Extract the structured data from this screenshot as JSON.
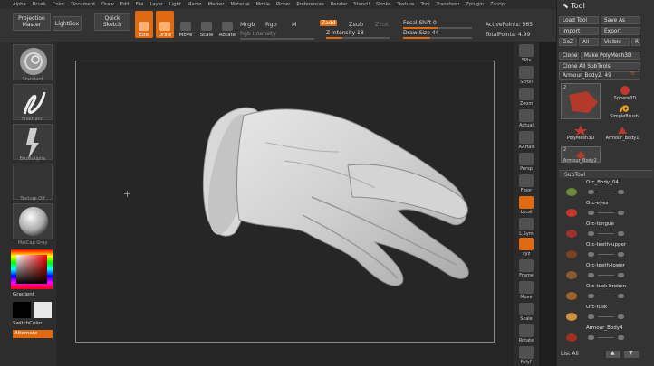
{
  "menubar": [
    "Alpha",
    "Brush",
    "Color",
    "Document",
    "Draw",
    "Edit",
    "File",
    "Layer",
    "Light",
    "Macro",
    "Marker",
    "Material",
    "Movie",
    "Picker",
    "Preferences",
    "Render",
    "Stencil",
    "Stroke",
    "Texture",
    "Tool",
    "Transform",
    "Zplugin",
    "Zscript"
  ],
  "topshelf": {
    "projection_master": "Projection Master",
    "lightbox": "LightBox",
    "quick_sketch": "Quick Sketch",
    "edit": "Edit",
    "draw": "Draw",
    "move": "Move",
    "scale": "Scale",
    "rotate": "Rotate",
    "mrgb": "Mrgb",
    "rgb": "Rgb",
    "m": "M",
    "rgb_intensity": "Rgb Intensity",
    "zadd": "Zadd",
    "zsub": "Zsub",
    "zcut": "Zcut",
    "z_intensity": "Z Intensity 18",
    "focal_shift": "Focal Shift 0",
    "draw_size": "Draw Size 44",
    "active_points": "ActivePoints: 565",
    "total_points": "TotalPoints: 4.99"
  },
  "leftshelf": {
    "standard": "Standard",
    "freehand": "FreeHand",
    "brushalpha": "BrushAlpha",
    "texture_off": "Texture Off",
    "material": "MatCap Gray",
    "gradient": "Gradient",
    "switchcolor": "SwitchColor",
    "alternate": "Alternate"
  },
  "rightshelf": [
    "SPix",
    "Scroll",
    "Zoom",
    "Actual",
    "AAHalf",
    "Persp",
    "Floor",
    "Local",
    "L.Sym",
    "xyz",
    "Frame",
    "Move",
    "Scale",
    "Rotate",
    "PolyF"
  ],
  "toolpanel": {
    "title": "Tool",
    "load_tool": "Load Tool",
    "save_as": "Save As",
    "import": "Import",
    "export": "Export",
    "goz": "GoZ",
    "all": "All",
    "visible": "Visible",
    "r": "R",
    "clone": "Clone",
    "make_polymesh": "Make PolyMesh3D",
    "clone_all_subtools": "Clone All SubTools",
    "current_tool": "Armour_Body2. 49",
    "tools": [
      "Sphere3D",
      "SimpleBrush",
      "PolyMesh3D",
      "Armour_Body1",
      "Armour_Body2"
    ],
    "tool_count": "2",
    "subtool_title": "SubTool",
    "subtools": [
      "Orc_Body_04",
      "Orc-eyes",
      "Orc-tongue",
      "Orc-teeth-upper",
      "Orc-teeth-lower",
      "Orc-tusk-broken",
      "Orc-tusk",
      "Armour_Body4"
    ],
    "list_all": "List All"
  }
}
